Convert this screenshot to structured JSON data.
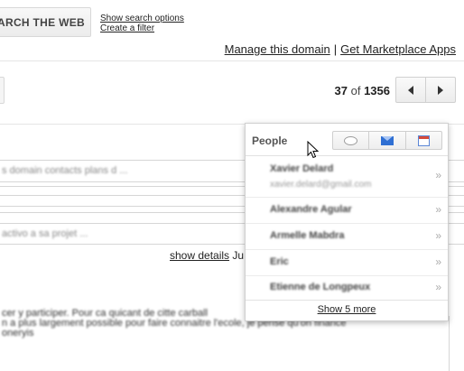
{
  "header": {
    "search_web_label": "ARCH THE WEB",
    "show_search_options": "Show search options",
    "create_filter": "Create a filter",
    "manage_domain": "Manage this domain",
    "separator": "|",
    "marketplace": "Get Marketplace Apps"
  },
  "pager": {
    "current": "37",
    "of": "of",
    "total": "1356"
  },
  "thread": {
    "quoted_line_1": "s domain contacts plans d ...",
    "quoted_line_2": "activo a sa projet ...",
    "show_details": "show details",
    "date_stub": "Ju",
    "body_line_1": "cer y participer. Pour ca quicant de citte carball",
    "body_line_2": "n a plus largement possible pour faire connaitre l'ecole, je pense qu'on finance",
    "body_line_3": "oneryis"
  },
  "people_card": {
    "title": "People",
    "actions": [
      {
        "icon": "chat-bubble-icon"
      },
      {
        "icon": "mail-icon"
      },
      {
        "icon": "calendar-icon"
      }
    ],
    "people": [
      {
        "name": "Xavier Delard",
        "email": "xavier.delard@gmail.com"
      },
      {
        "name": "Alexandre Agular",
        "email": ""
      },
      {
        "name": "Armelle Mabdra",
        "email": ""
      },
      {
        "name": "Eric",
        "email": ""
      },
      {
        "name": "Etienne de Longpeux",
        "email": ""
      }
    ],
    "show_more": "Show 5 more"
  },
  "colors": {
    "mail_blue": "#2f6fd3",
    "calendar_red": "#d64a3a"
  }
}
